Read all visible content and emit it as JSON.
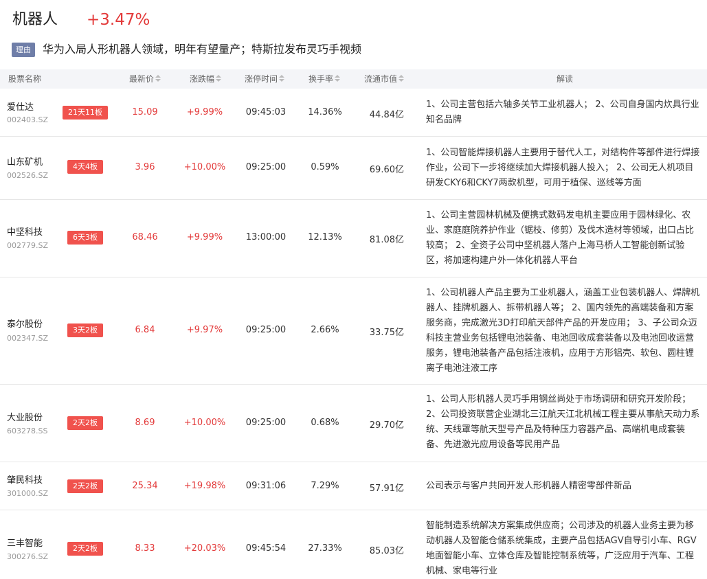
{
  "sector": {
    "name": "机器人",
    "change": "+3.47%",
    "reason_tag": "理由",
    "reason_text": "华为入局人形机器人领域，明年有望量产；特斯拉发布灵巧手视频"
  },
  "table": {
    "headers": {
      "name": "股票名称",
      "price": "最新价",
      "change": "涨跌幅",
      "limit_time": "涨停时间",
      "turnover": "换手率",
      "market_cap": "流通市值",
      "analysis": "解读"
    },
    "rows": [
      {
        "name": "爱仕达",
        "code": "002403.SZ",
        "badge": "21天11板",
        "price": "15.09",
        "change": "+9.99%",
        "time": "09:45:03",
        "turnover": "14.36%",
        "cap": "44.84亿",
        "desc": "1、公司主营包括六轴多关节工业机器人； 2、公司自身国内炊具行业知名品牌"
      },
      {
        "name": "山东矿机",
        "code": "002526.SZ",
        "badge": "4天4板",
        "price": "3.96",
        "change": "+10.00%",
        "time": "09:25:00",
        "turnover": "0.59%",
        "cap": "69.60亿",
        "desc": "1、公司智能焊接机器人主要用于替代人工，对结构件等部件进行焊接作业，公司下一步将继续加大焊接机器人投入； 2、公司无人机项目研发CKY6和CKY7两款机型，可用于植保、巡线等方面"
      },
      {
        "name": "中坚科技",
        "code": "002779.SZ",
        "badge": "6天3板",
        "price": "68.46",
        "change": "+9.99%",
        "time": "13:00:00",
        "turnover": "12.13%",
        "cap": "81.08亿",
        "desc": "1、公司主营园林机械及便携式数码发电机主要应用于园林绿化、农业、家庭庭院养护作业（锯枝、修剪）及伐木造材等领域，出口占比较高； 2、全资子公司中坚机器人落户上海马桥人工智能创新试验区，将加速构建户外一体化机器人平台"
      },
      {
        "name": "泰尔股份",
        "code": "002347.SZ",
        "badge": "3天2板",
        "price": "6.84",
        "change": "+9.97%",
        "time": "09:25:00",
        "turnover": "2.66%",
        "cap": "33.75亿",
        "desc": "1、公司机器人产品主要为工业机器人，涵盖工业包装机器人、焊牌机器人、挂牌机器人、拆带机器人等； 2、国内领先的高端装备和方案服务商，完成激光3D打印航天部件产品的开发应用； 3、子公司众迈科技主营业务包括锂电池装备、电池回收成套装备以及电池回收运营服务，锂电池装备产品包括注液机，应用于方形铝壳、软包、圆柱锂离子电池注液工序"
      },
      {
        "name": "大业股份",
        "code": "603278.SS",
        "badge": "2天2板",
        "price": "8.69",
        "change": "+10.00%",
        "time": "09:25:00",
        "turnover": "0.68%",
        "cap": "29.70亿",
        "desc": "1、公司人形机器人灵巧手用钢丝尚处于市场调研和研究开发阶段； 2、公司投资联营企业湖北三江航天江北机械工程主要从事航天动力系统、天线罩等航天型号产品及特种压力容器产品、高端机电成套装备、先进激光应用设备等民用产品"
      },
      {
        "name": "肇民科技",
        "code": "301000.SZ",
        "badge": "2天2板",
        "price": "25.34",
        "change": "+19.98%",
        "time": "09:31:06",
        "turnover": "7.29%",
        "cap": "57.91亿",
        "desc": "公司表示与客户共同开发人形机器人精密零部件新品"
      },
      {
        "name": "三丰智能",
        "code": "300276.SZ",
        "badge": "2天2板",
        "price": "8.33",
        "change": "+20.03%",
        "time": "09:45:54",
        "turnover": "27.33%",
        "cap": "85.03亿",
        "desc": "智能制造系统解决方案集成供应商；公司涉及的机器人业务主要为移动机器人及智能仓储系统集成，主要产品包括AGV自导引小车、RGV地面智能小车、立体仓库及智能控制系统等，广泛应用于汽车、工程机械、家电等行业"
      }
    ]
  }
}
